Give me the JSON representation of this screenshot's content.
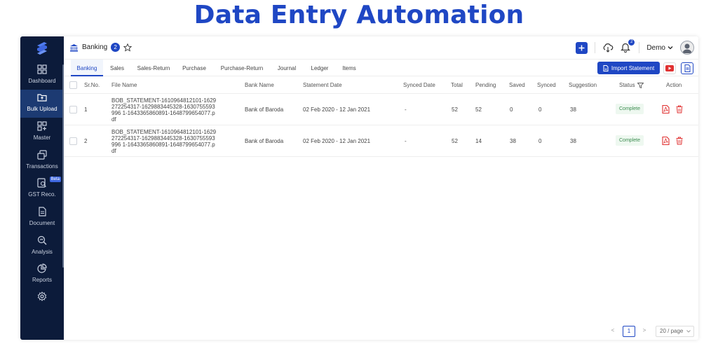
{
  "headline": "Data Entry Automation",
  "colors": {
    "primary": "#1f47c4",
    "sidebar": "#0c1b3a",
    "sidebar_active": "#1c3a72",
    "danger": "#e03131",
    "success": "#3c8c50"
  },
  "sidebar": {
    "logo_icon": "brand-s-logo",
    "items": [
      {
        "label": "Dashboard",
        "icon": "dashboard-icon"
      },
      {
        "label": "Bulk Upload",
        "icon": "upload-folder-icon",
        "active": true
      },
      {
        "label": "Master",
        "icon": "master-grid-icon"
      },
      {
        "label": "Transactions",
        "icon": "transactions-icon"
      },
      {
        "label": "GST Reco.",
        "icon": "gst-reco-icon",
        "badge": "Beta"
      },
      {
        "label": "Document",
        "icon": "document-icon"
      },
      {
        "label": "Analysis",
        "icon": "analysis-icon"
      },
      {
        "label": "Reports",
        "icon": "reports-icon"
      },
      {
        "label": "",
        "icon": "settings-gear-icon"
      }
    ]
  },
  "topbar": {
    "title": "Banking",
    "count": "2",
    "notifications": "2",
    "user": "Demo"
  },
  "tabs": [
    "Banking",
    "Sales",
    "Sales-Return",
    "Purchase",
    "Purchase-Return",
    "Journal",
    "Ledger",
    "Items"
  ],
  "active_tab": "Banking",
  "actions": {
    "import_label": "Import Statement"
  },
  "table": {
    "headers": [
      "Sr.No.",
      "File Name",
      "Bank Name",
      "Statement Date",
      "Synced Date",
      "Total",
      "Pending",
      "Saved",
      "Synced",
      "Suggestion",
      "Status",
      "Action"
    ],
    "rows": [
      {
        "sr": "1",
        "file": "BOB_STATEMENT-1610964812101-1629272254317-1629883445328-1630755593996 1-1643365860891-1648799654077.pdf",
        "bank": "Bank of Baroda",
        "statement_date": "02 Feb 2020 - 12 Jan 2021",
        "synced_date": "-",
        "total": "52",
        "pending": "52",
        "saved": "0",
        "synced": "0",
        "suggestion": "38",
        "status": "Complete"
      },
      {
        "sr": "2",
        "file": "BOB_STATEMENT-1610964812101-1629272254317-1629883445328-1630755593996 1-1643365860891-1648799654077.pdf",
        "bank": "Bank of Baroda",
        "statement_date": "02 Feb 2020 - 12 Jan 2021",
        "synced_date": "-",
        "total": "52",
        "pending": "14",
        "saved": "38",
        "synced": "0",
        "suggestion": "38",
        "status": "Complete"
      }
    ]
  },
  "pagination": {
    "prev": "<",
    "current": "1",
    "next": ">",
    "page_size": "20 / page"
  }
}
